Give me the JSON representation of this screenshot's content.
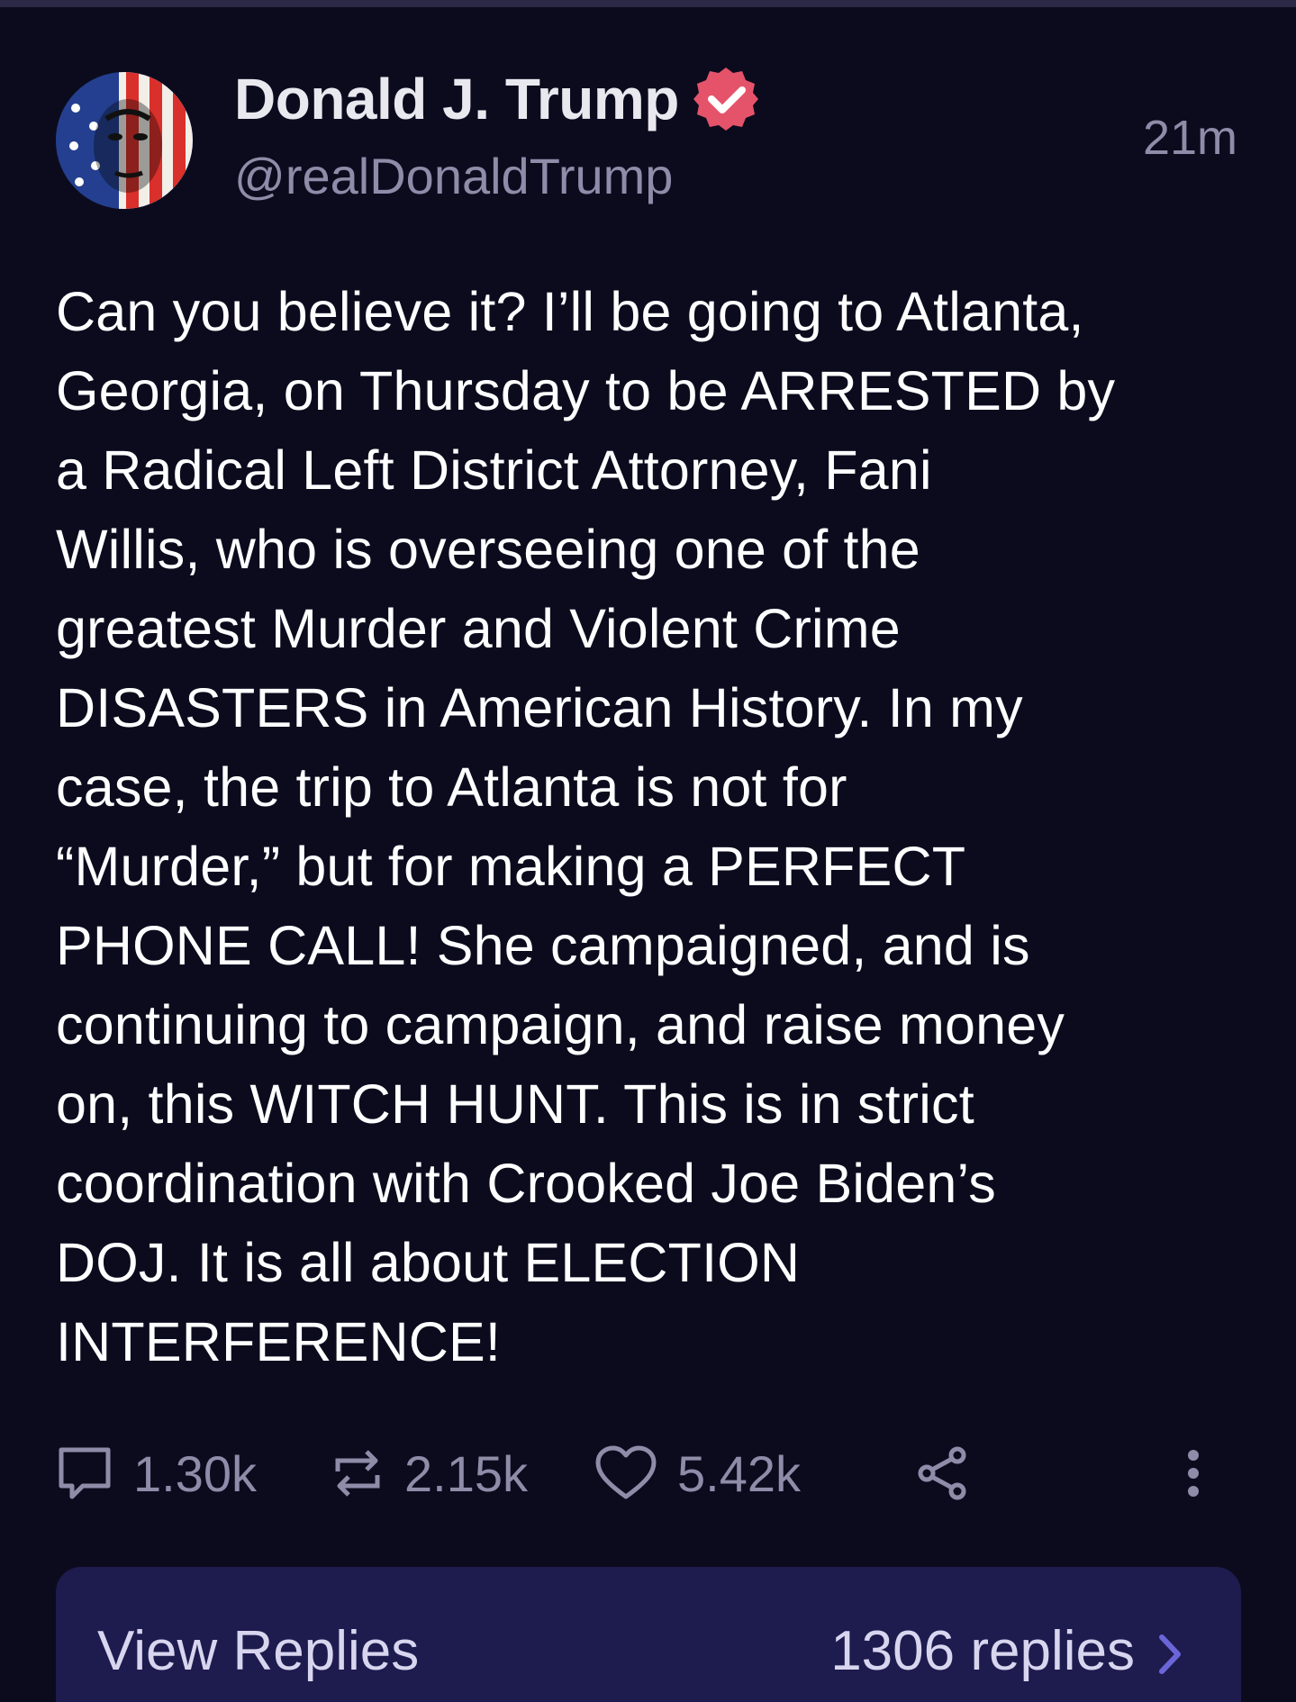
{
  "post": {
    "author_name": "Donald J. Trump",
    "author_handle": "@realDonaldTrump",
    "time_ago": "21m",
    "verified": true,
    "text": "Can you believe it? I’ll be going to Atlanta,\nGeorgia, on Thursday to be ARRESTED by\na Radical Left District Attorney, Fani\nWillis, who is overseeing one of the\ngreatest Murder and Violent Crime\nDISASTERS in American History. In my\ncase, the trip to Atlanta is not for\n“Murder,” but for making a PERFECT\nPHONE CALL! She campaigned, and is\ncontinuing to campaign, and raise money\non, this WITCH HUNT. This is in strict\ncoordination with Crooked Joe Biden’s\nDOJ. It is all about ELECTION\nINTERFERENCE!"
  },
  "actions": {
    "replies_count": "1.30k",
    "reposts_count": "2.15k",
    "likes_count": "5.42k",
    "icons": [
      "reply-icon",
      "repost-icon",
      "heart-icon",
      "share-icon",
      "more-icon"
    ]
  },
  "replies_bar": {
    "label": "View Replies",
    "count_text": "1306 replies"
  },
  "colors": {
    "background": "#0c0b1e",
    "muted_text": "#8e8ca8",
    "verified_badge": "#e5536a",
    "replies_bar_bg": "#1e1b4f",
    "chevron": "#6b66d8"
  }
}
